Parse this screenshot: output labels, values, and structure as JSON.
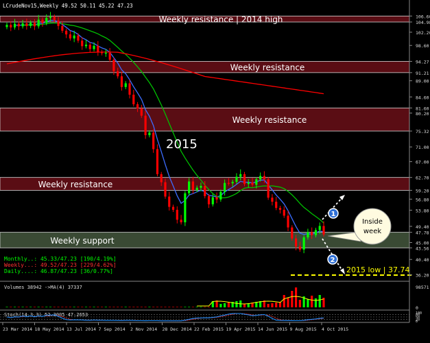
{
  "window": {
    "title": "LCrudeNov15,Weekly  49.52 50.11 45.22 47.23"
  },
  "zones": [
    {
      "label": "Weekly resistance | 2014 high",
      "kind": "resistance",
      "top": 106.6,
      "bottom": 104.98
    },
    {
      "label": "Weekly resistance",
      "kind": "resistance",
      "top": 94.27,
      "bottom": 91.21
    },
    {
      "label": "Weekly resistance",
      "kind": "resistance",
      "top": 81.6,
      "bottom": 75.32
    },
    {
      "label": "Weekly resistance",
      "kind": "resistance",
      "top": 62.7,
      "bottom": 59.2
    },
    {
      "label": "Weekly support",
      "kind": "support",
      "top": 47.78,
      "bottom": 43.56
    }
  ],
  "annotations": {
    "year_label": "2015",
    "callout": "Inside week",
    "marker_1": "1",
    "marker_2": "2",
    "low_label": "2015 low | 37.74",
    "low_value": 37.74
  },
  "indicators": [
    {
      "text": "Monthly..: 45.33/47.23 [190/4.19%]",
      "color": "#00ff00"
    },
    {
      "text": "Weekly...: 49.52/47.23 [229/4.62%]",
      "color": "#ff3030"
    },
    {
      "text": "Daily....: 46.87/47.23 [36/0.77%]",
      "color": "#00ff00"
    }
  ],
  "price_axis_labels": [
    "106.60",
    "104.98",
    "102.20",
    "98.60",
    "94.27",
    "91.21",
    "89.00",
    "84.60",
    "81.60",
    "80.20",
    "75.32",
    "71.00",
    "67.00",
    "62.70",
    "59.20",
    "56.80",
    "53.80",
    "49.40",
    "47.78",
    "45.00",
    "43.56",
    "40.40",
    "36.20"
  ],
  "volume_panel": {
    "label": "Volumes 38942  ->MA(4) 37337",
    "axis_labels": [
      "98571",
      "0"
    ]
  },
  "stoch_panel": {
    "label": "Stoch(14,3,3) 52.3005 47.2653",
    "axis_labels": [
      "100",
      "80",
      "50",
      "20",
      "0"
    ]
  },
  "time_axis_labels": [
    "23 Mar 2014",
    "18 May 2014",
    "13 Jul 2014",
    "7 Sep 2014",
    "2 Nov 2014",
    "28 Dec 2014",
    "22 Feb 2015",
    "19 Apr 2015",
    "14 Jun 2015",
    "9 Aug 2015",
    "4 Oct 2015"
  ],
  "colors": {
    "bull_candle": "#00ff00",
    "bear_candle": "#ff0000",
    "resistance_zone": "#5a0d14",
    "support_zone": "#3a4a34",
    "ma_fast": "#3c6cff",
    "ma_mid": "#00c000",
    "ma_slow": "#ff0000",
    "low_line": "#ffff00",
    "stoch_main": "#1e90ff"
  },
  "chart_data": {
    "type": "candlestick",
    "ylim": [
      36.2,
      106.6
    ],
    "x": [
      "2014-03-23",
      "2014-03-30",
      "2014-04-06",
      "2014-04-13",
      "2014-04-20",
      "2014-04-27",
      "2014-05-04",
      "2014-05-11",
      "2014-05-18",
      "2014-05-25",
      "2014-06-01",
      "2014-06-08",
      "2014-06-15",
      "2014-06-22",
      "2014-06-29",
      "2014-07-06",
      "2014-07-13",
      "2014-07-20",
      "2014-07-27",
      "2014-08-03",
      "2014-08-10",
      "2014-08-17",
      "2014-08-24",
      "2014-08-31",
      "2014-09-07",
      "2014-09-14",
      "2014-09-21",
      "2014-09-28",
      "2014-10-05",
      "2014-10-12",
      "2014-10-19",
      "2014-10-26",
      "2014-11-02",
      "2014-11-09",
      "2014-11-16",
      "2014-11-23",
      "2014-11-30",
      "2014-12-07",
      "2014-12-14",
      "2014-12-21",
      "2014-12-28",
      "2015-01-04",
      "2015-01-11",
      "2015-01-18",
      "2015-01-25",
      "2015-02-01",
      "2015-02-08",
      "2015-02-15",
      "2015-02-22",
      "2015-03-01",
      "2015-03-08",
      "2015-03-15",
      "2015-03-22",
      "2015-03-29",
      "2015-04-05",
      "2015-04-12",
      "2015-04-19",
      "2015-04-26",
      "2015-05-03",
      "2015-05-10",
      "2015-05-17",
      "2015-05-24",
      "2015-05-31",
      "2015-06-07",
      "2015-06-14",
      "2015-06-21",
      "2015-06-28",
      "2015-07-05",
      "2015-07-12",
      "2015-07-19",
      "2015-07-26",
      "2015-08-02",
      "2015-08-09",
      "2015-08-16",
      "2015-08-23",
      "2015-08-30",
      "2015-09-06",
      "2015-09-13",
      "2015-09-20",
      "2015-09-27",
      "2015-10-04"
    ],
    "close": [
      104.2,
      103.5,
      104.5,
      103.8,
      104.6,
      103.9,
      104.8,
      103.8,
      105.6,
      104.7,
      106.1,
      106.4,
      105.4,
      103.9,
      102.6,
      101.6,
      100.5,
      101.3,
      99.9,
      98.4,
      98.8,
      97.6,
      98.5,
      96.8,
      96.5,
      96.6,
      94.7,
      91.6,
      90.2,
      87.3,
      88.3,
      85.2,
      82.6,
      81.5,
      79.5,
      74.2,
      74.9,
      70.4,
      63.6,
      61.4,
      57.5,
      54.7,
      53.9,
      51.2,
      50.5,
      58.4,
      61.6,
      59.3,
      59.9,
      60.4,
      57.6,
      55.4,
      57.3,
      56.7,
      58.8,
      61.2,
      61.1,
      61.5,
      62.9,
      63.6,
      60.9,
      61.3,
      60.7,
      62.2,
      63.1,
      62.2,
      57.2,
      56.1,
      54.4,
      53.9,
      52.3,
      49.1,
      46.1,
      43.9,
      43.1,
      46.4,
      47.8,
      47.0,
      48.4,
      49.5,
      47.2
    ]
  }
}
